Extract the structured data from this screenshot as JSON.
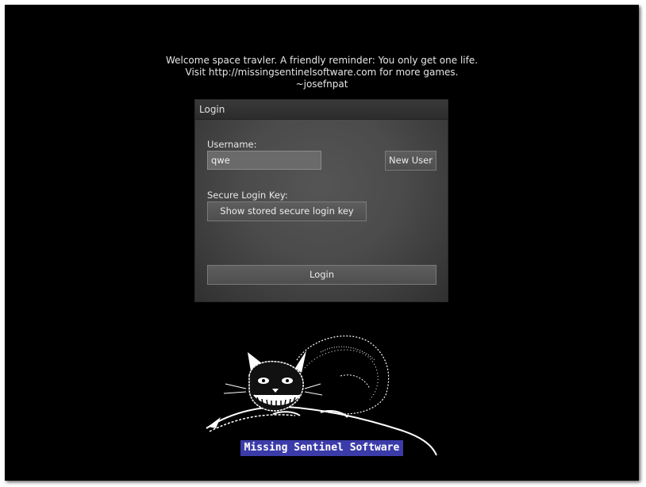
{
  "welcome": {
    "line1": "Welcome space travler. A friendly reminder: You only get one life.",
    "line2": "Visit http://missingsentinelsoftware.com for more games.",
    "line3": "~josefnpat"
  },
  "login_panel": {
    "title": "Login",
    "username_label": "Username:",
    "username_value": "qwe",
    "new_user_label": "New User",
    "key_label": "Secure Login Key:",
    "show_key_label": "Show stored secure login key",
    "login_label": "Login"
  },
  "logo": {
    "icon": "cheshire-cat-icon",
    "company_name": "Missing Sentinel Software"
  },
  "colors": {
    "background": "#000000",
    "panel": "#4b4b4b",
    "company_label_bg": "#3b3baa"
  }
}
